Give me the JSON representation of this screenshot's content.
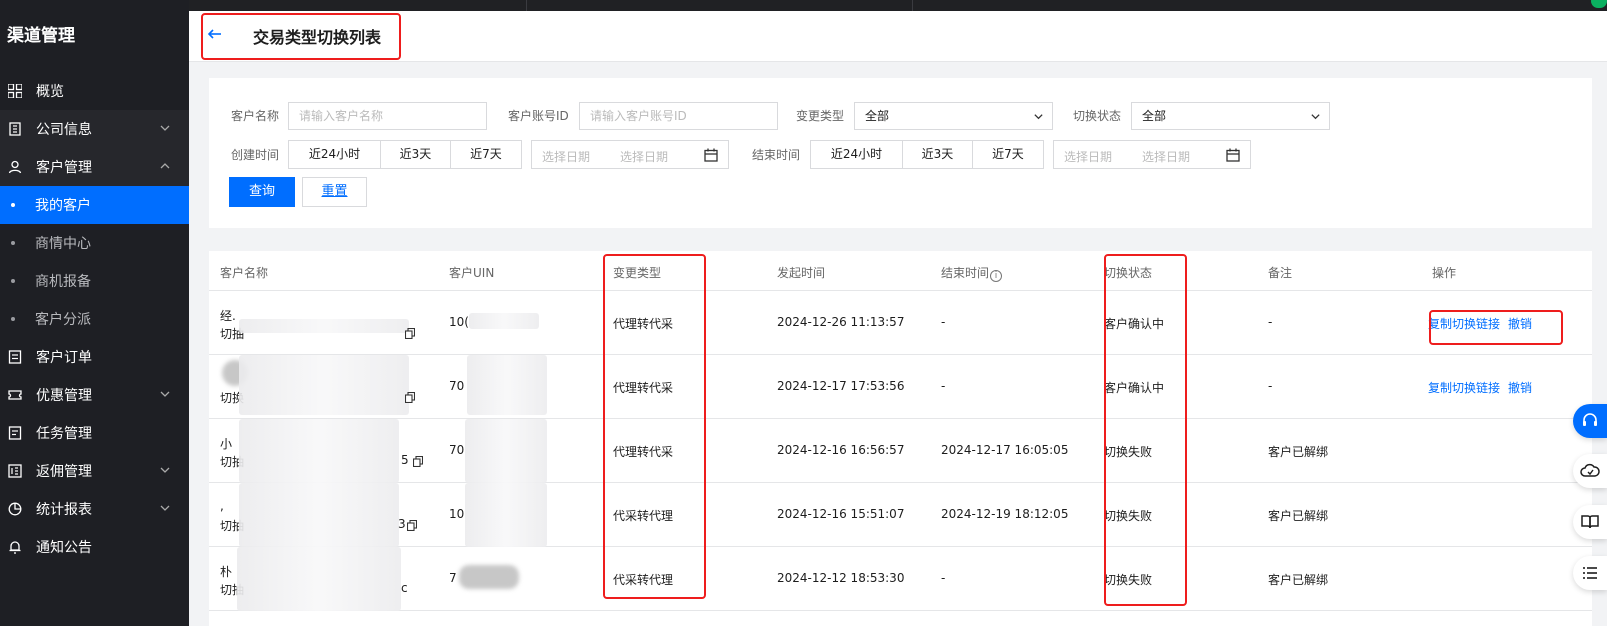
{
  "sidebar": {
    "title": "渠道管理",
    "items": [
      {
        "label": "概览",
        "icon": "grid-icon"
      },
      {
        "label": "公司信息",
        "icon": "building-icon"
      },
      {
        "label": "客户管理",
        "icon": "user-icon"
      },
      {
        "label": "我的客户"
      },
      {
        "label": "商情中心"
      },
      {
        "label": "商机报备"
      },
      {
        "label": "客户分派"
      },
      {
        "label": "客户订单",
        "icon": "order-icon"
      },
      {
        "label": "优惠管理",
        "icon": "coupon-icon"
      },
      {
        "label": "任务管理",
        "icon": "task-icon"
      },
      {
        "label": "返佣管理",
        "icon": "rebate-icon"
      },
      {
        "label": "统计报表",
        "icon": "pie-chart-icon"
      },
      {
        "label": "通知公告",
        "icon": "bell-icon"
      }
    ]
  },
  "header": {
    "title": "交易类型切换列表"
  },
  "filters": {
    "customer_name_label": "客户名称",
    "customer_name_placeholder": "请输入客户名称",
    "account_id_label": "客户账号ID",
    "account_id_placeholder": "请输入客户账号ID",
    "change_type_label": "变更类型",
    "change_type_value": "全部",
    "switch_status_label": "切换状态",
    "switch_status_value": "全部",
    "create_time_label": "创建时间",
    "end_time_label": "结束时间",
    "quick_ranges": [
      "近24小时",
      "近3天",
      "近7天"
    ],
    "date_placeholder": "选择日期",
    "query_button": "查询",
    "reset_button": "重置"
  },
  "table": {
    "columns": [
      "客户名称",
      "客户UIN",
      "变更类型",
      "发起时间",
      "结束时间",
      "切换状态",
      "备注",
      "操作"
    ],
    "rows": [
      {
        "name_line1": "经.",
        "name_line2": "切抽",
        "uin": "10(",
        "change_type": "代理转代采",
        "start": "2024-12-26 11:13:57",
        "end": "-",
        "status": "客户确认中",
        "remark": "-",
        "actions": [
          "复制切换链接",
          "撤销"
        ]
      },
      {
        "name_line1": "",
        "name_line2": "切换",
        "uin": "70",
        "change_type": "代理转代采",
        "start": "2024-12-17 17:53:56",
        "end": "-",
        "status": "客户确认中",
        "remark": "-",
        "actions": [
          "复制切换链接",
          "撤销"
        ]
      },
      {
        "name_line1": "小",
        "name_line2": "切抽",
        "name_tail": "5",
        "uin": "70",
        "change_type": "代理转代采",
        "start": "2024-12-16 16:56:57",
        "end": "2024-12-17 16:05:05",
        "status": "切换失败",
        "remark": "客户已解绑",
        "actions": []
      },
      {
        "name_line1": ",",
        "name_line2": "切抽",
        "name_tail": "3",
        "uin": "10",
        "change_type": "代采转代理",
        "start": "2024-12-16 15:51:07",
        "end": "2024-12-19 18:12:05",
        "status": "切换失败",
        "remark": "客户已解绑",
        "actions": []
      },
      {
        "name_line1": "朴",
        "name_line2": "切抽",
        "name_tail": "c",
        "uin": "7",
        "change_type": "代采转代理",
        "start": "2024-12-12 18:53:30",
        "end": "-",
        "status": "切换失败",
        "remark": "客户已解绑",
        "actions": []
      }
    ]
  },
  "colors": {
    "accent": "#006eff",
    "highlight": "#ee1d1d",
    "sidebar_bg": "#1e1f24"
  }
}
